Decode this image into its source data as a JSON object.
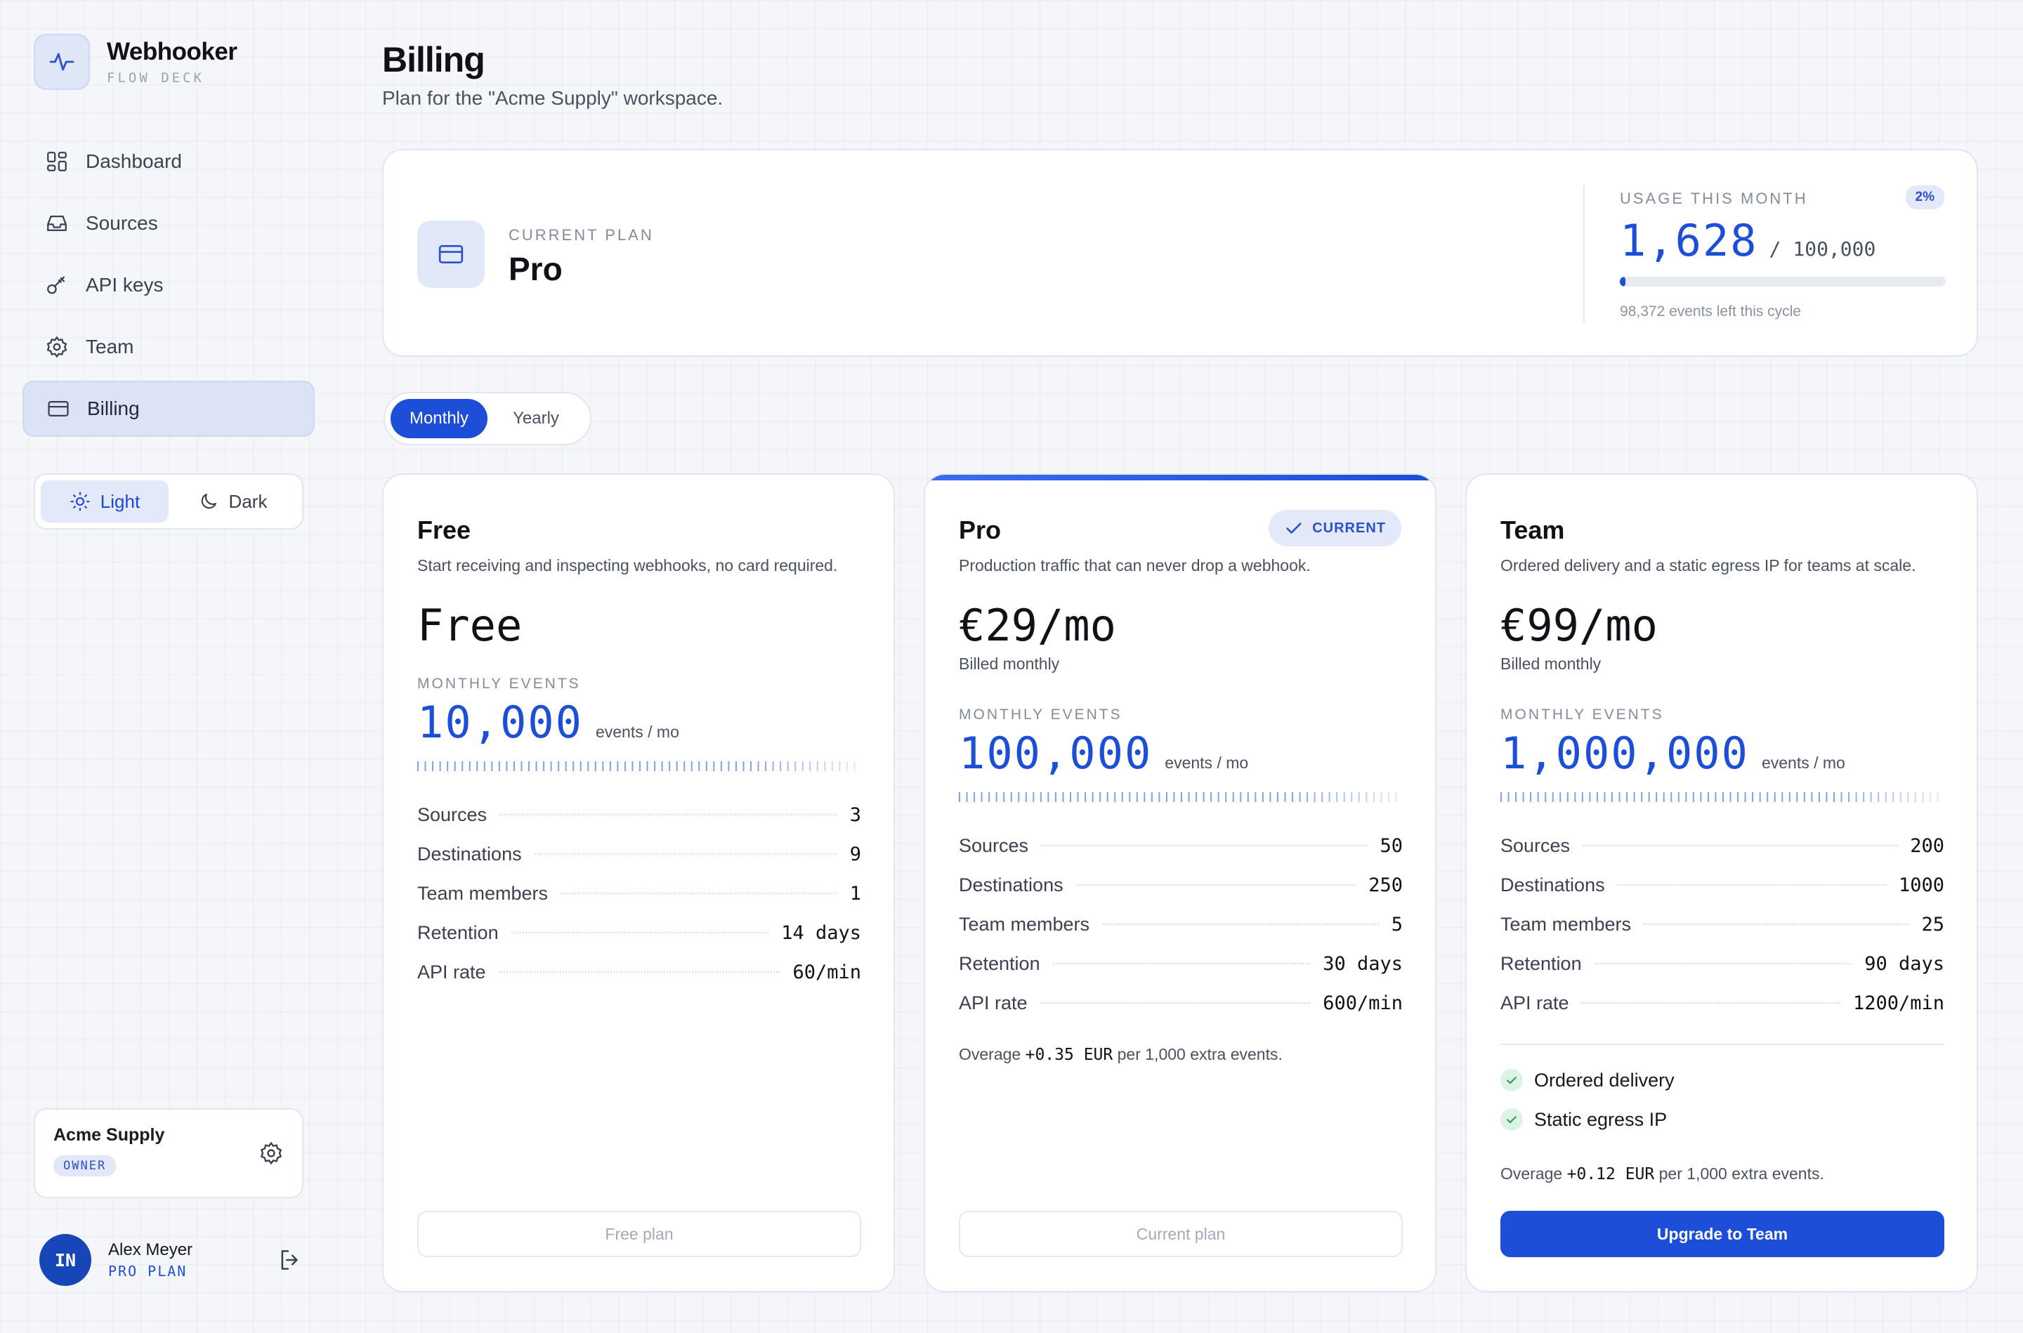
{
  "brand": {
    "name": "Webhooker",
    "subtitle": "FLOW DECK",
    "logo_icon": "pulse-icon"
  },
  "sidebar": {
    "items": [
      {
        "label": "Dashboard",
        "icon": "dashboard-icon",
        "active": false
      },
      {
        "label": "Sources",
        "icon": "inbox-icon",
        "active": false
      },
      {
        "label": "API keys",
        "icon": "key-icon",
        "active": false
      },
      {
        "label": "Team",
        "icon": "gear-icon",
        "active": false
      },
      {
        "label": "Billing",
        "icon": "card-icon",
        "active": true
      }
    ],
    "theme": {
      "light": "Light",
      "dark": "Dark",
      "selected": "light"
    },
    "workspace": {
      "name": "Acme Supply",
      "role": "OWNER"
    },
    "user": {
      "initials": "IN",
      "name": "Alex Meyer",
      "plan": "PRO PLAN"
    }
  },
  "header": {
    "title": "Billing",
    "subtitle": "Plan for the \"Acme Supply\" workspace."
  },
  "current_plan": {
    "label": "CURRENT PLAN",
    "name": "Pro",
    "usage_label": "USAGE THIS MONTH",
    "usage_percent": "2%",
    "usage_fraction": 0.01628,
    "used": "1,628",
    "total": "/ 100,000",
    "remaining": "98,372 events left this cycle"
  },
  "billing_cycle": {
    "monthly": "Monthly",
    "yearly": "Yearly",
    "selected": "monthly"
  },
  "tiers": [
    {
      "name": "Free",
      "description": "Start receiving and inspecting webhooks, no card required.",
      "price": "Free",
      "billed": "",
      "events_label": "MONTHLY EVENTS",
      "events": "10,000",
      "events_unit": "events / mo",
      "specs": [
        {
          "k": "Sources",
          "v": "3"
        },
        {
          "k": "Destinations",
          "v": "9"
        },
        {
          "k": "Team members",
          "v": "1"
        },
        {
          "k": "Retention",
          "v": "14 days"
        },
        {
          "k": "API rate",
          "v": "60/min"
        }
      ],
      "button": "Free plan"
    },
    {
      "name": "Pro",
      "badge": "CURRENT",
      "description": "Production traffic that can never drop a webhook.",
      "price": "€29/mo",
      "billed": "Billed monthly",
      "events_label": "MONTHLY EVENTS",
      "events": "100,000",
      "events_unit": "events / mo",
      "specs": [
        {
          "k": "Sources",
          "v": "50"
        },
        {
          "k": "Destinations",
          "v": "250"
        },
        {
          "k": "Team members",
          "v": "5"
        },
        {
          "k": "Retention",
          "v": "30 days"
        },
        {
          "k": "API rate",
          "v": "600/min"
        }
      ],
      "overage_prefix": "Overage",
      "overage_value": "+0.35 EUR",
      "overage_suffix": "per 1,000 extra events.",
      "button": "Current plan"
    },
    {
      "name": "Team",
      "description": "Ordered delivery and a static egress IP for teams at scale.",
      "price": "€99/mo",
      "billed": "Billed monthly",
      "events_label": "MONTHLY EVENTS",
      "events": "1,000,000",
      "events_unit": "events / mo",
      "specs": [
        {
          "k": "Sources",
          "v": "200"
        },
        {
          "k": "Destinations",
          "v": "1000"
        },
        {
          "k": "Team members",
          "v": "25"
        },
        {
          "k": "Retention",
          "v": "90 days"
        },
        {
          "k": "API rate",
          "v": "1200/min"
        }
      ],
      "features": [
        "Ordered delivery",
        "Static egress IP"
      ],
      "overage_prefix": "Overage",
      "overage_value": "+0.12 EUR",
      "overage_suffix": "per 1,000 extra events.",
      "button": "Upgrade to Team"
    }
  ],
  "colors": {
    "accent": "#1d4ed8",
    "accent_soft": "#e3e9f8",
    "success": "#2f9e5b"
  }
}
